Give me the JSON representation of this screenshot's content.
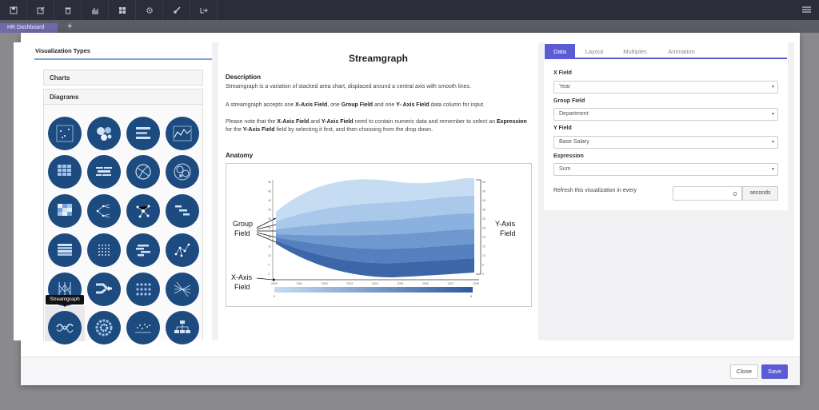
{
  "topbar": {
    "icons": [
      "save-icon",
      "edit-icon",
      "trash-icon",
      "chart-icon",
      "grid-icon",
      "gear-icon",
      "brush-icon",
      "export-icon"
    ],
    "menu_icon": "hamburger-icon"
  },
  "tabs": {
    "active": "HR Dashboard",
    "add": "+"
  },
  "left": {
    "title": "Visualization Types",
    "sections": [
      "Charts",
      "Diagrams"
    ],
    "tooltip": "Streamgraph"
  },
  "middle": {
    "title": "Streamgraph",
    "description_heading": "Description",
    "description_p1": "Streamgraph is a variation of stacked area chart, displaced around a central axis with smooth lines.",
    "p2_a": "A streamgraph accepts one ",
    "p2_b": "X-Axis Field",
    "p2_c": ", one ",
    "p2_d": "Group Field",
    "p2_e": " and one ",
    "p2_f": "Y- Axis Field",
    "p2_g": " data column for input.",
    "p3_a": "Please note that the ",
    "p3_b": "X-Axis Field",
    "p3_c": " and ",
    "p3_d": "Y-Axis Field",
    "p3_e": " need to contain numeric data and remember to select an ",
    "p3_f": "Expression",
    "p3_g": " for the ",
    "p3_h": "Y-Axis Field",
    "p3_i": " field by selecting it first, and then choosing from the drop down.",
    "anatomy_heading": "Anatomy",
    "anatomy": {
      "group_label_1": "Group",
      "group_label_2": "Field",
      "xaxis_label_1": "X-Axis",
      "xaxis_label_2": "Field",
      "yaxis_label_1": "Y-Axis",
      "yaxis_label_2": "Field",
      "x_ticks": [
        "2000",
        "2001",
        "2002",
        "2003",
        "2004",
        "2005",
        "2006",
        "2007",
        "2008"
      ],
      "y_ticks": [
        "50",
        "45",
        "40",
        "35",
        "30",
        "25",
        "20",
        "15",
        "10",
        "5",
        "0"
      ],
      "legend_min": "0",
      "legend_max": "8"
    }
  },
  "right": {
    "tabs": [
      "Data",
      "Layout",
      "Multiples",
      "Animation"
    ],
    "x_field_label": "X Field",
    "x_field_value": "Year",
    "group_field_label": "Group Field",
    "group_field_value": "Department",
    "y_field_label": "Y Field",
    "y_field_value": "Base Salary",
    "expression_label": "Expression",
    "expression_value": "Sum",
    "refresh_label": "Refresh this visualization in every",
    "refresh_value": "0",
    "refresh_unit": "seconds",
    "caret": "▾"
  },
  "footer": {
    "close": "Close",
    "save": "Save"
  },
  "colors": {
    "accent": "#5b5bd6",
    "icon_bg": "#1d4a7f",
    "topbar": "#2c2c3a"
  }
}
